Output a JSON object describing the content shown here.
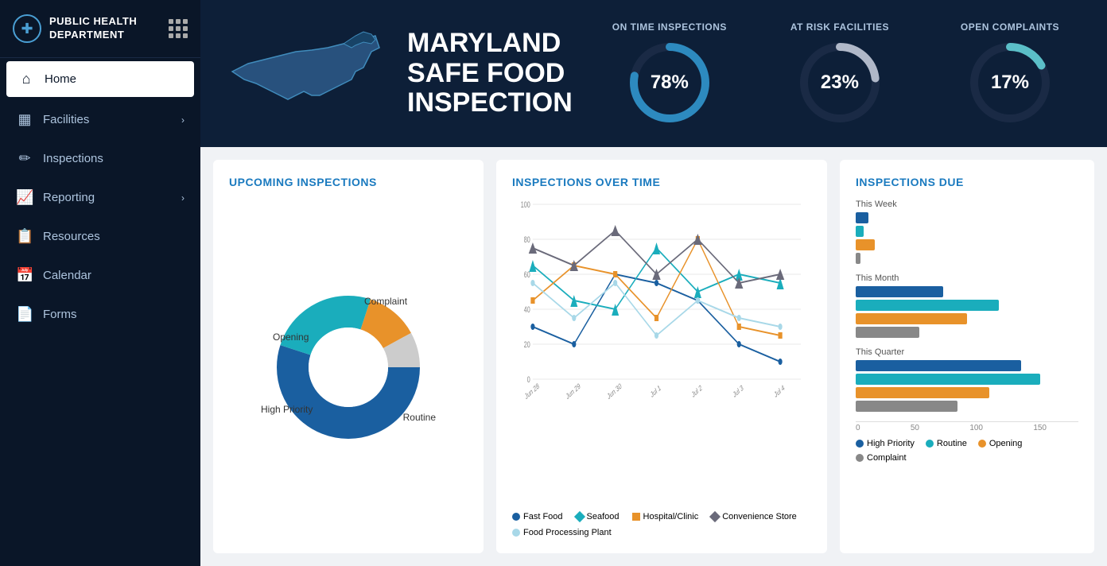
{
  "sidebar": {
    "logo_line1": "PUBLIC HEALTH",
    "logo_line2": "DEPARTMENT",
    "items": [
      {
        "id": "home",
        "label": "Home",
        "icon": "⌂",
        "active": true,
        "arrow": false
      },
      {
        "id": "facilities",
        "label": "Facilities",
        "icon": "▦",
        "active": false,
        "arrow": true
      },
      {
        "id": "inspections",
        "label": "Inspections",
        "icon": "✏",
        "active": false,
        "arrow": false
      },
      {
        "id": "reporting",
        "label": "Reporting",
        "icon": "📈",
        "active": false,
        "arrow": true
      },
      {
        "id": "resources",
        "label": "Resources",
        "icon": "📋",
        "active": false,
        "arrow": false
      },
      {
        "id": "calendar",
        "label": "Calendar",
        "icon": "📅",
        "active": false,
        "arrow": false
      },
      {
        "id": "forms",
        "label": "Forms",
        "icon": "📄",
        "active": false,
        "arrow": false
      }
    ]
  },
  "header": {
    "title_line1": "MARYLAND",
    "title_line2": "SAFE FOOD",
    "title_line3": "INSPECTION",
    "stats": [
      {
        "label": "ON TIME INSPECTIONS",
        "value": "78%",
        "percent": 78,
        "color": "#2d8abf"
      },
      {
        "label": "AT RISK FACILITIES",
        "value": "23%",
        "percent": 23,
        "color": "#b0b8c8"
      },
      {
        "label": "OPEN COMPLAINTS",
        "value": "17%",
        "percent": 17,
        "color": "#5bbfc8"
      }
    ]
  },
  "upcoming_inspections": {
    "title": "UPCOMING INSPECTIONS",
    "segments": [
      {
        "label": "Routine",
        "value": 55,
        "color": "#1a5fa0"
      },
      {
        "label": "High Priority",
        "value": 25,
        "color": "#1aadbc"
      },
      {
        "label": "Opening",
        "value": 12,
        "color": "#e8922a"
      },
      {
        "label": "Complaint",
        "value": 8,
        "color": "#ccc"
      }
    ]
  },
  "inspections_over_time": {
    "title": "INSPECTIONS OVER TIME",
    "y_labels": [
      100,
      80,
      60,
      40,
      20,
      0
    ],
    "x_labels": [
      "Jun 28",
      "Jun 29",
      "Jun 30",
      "Jul 1",
      "Jul 2",
      "Jul 3",
      "Jul 4"
    ],
    "series": [
      {
        "name": "Fast Food",
        "color": "#1a5fa0",
        "points": [
          30,
          20,
          60,
          55,
          45,
          20,
          10
        ]
      },
      {
        "name": "Seafood",
        "color": "#1aadbc",
        "points": [
          65,
          45,
          40,
          75,
          50,
          60,
          55
        ]
      },
      {
        "name": "Hospital/Clinic",
        "color": "#e8922a",
        "points": [
          45,
          65,
          60,
          35,
          80,
          30,
          25
        ]
      },
      {
        "name": "Convenience Store",
        "color": "#6a6a7a",
        "points": [
          75,
          65,
          85,
          60,
          80,
          55,
          60
        ]
      },
      {
        "name": "Food Processing Plant",
        "color": "#a8d8e8",
        "points": [
          55,
          35,
          55,
          25,
          45,
          35,
          30
        ]
      }
    ]
  },
  "inspections_due": {
    "title": "INSPECTIONS DUE",
    "groups": [
      {
        "label": "This Week",
        "bars": [
          {
            "type": "High Priority",
            "color": "#1a5fa0",
            "value": 8
          },
          {
            "type": "Routine",
            "color": "#1aadbc",
            "value": 5
          },
          {
            "type": "Opening",
            "color": "#e8922a",
            "value": 12
          },
          {
            "type": "Complaint",
            "color": "#888",
            "value": 3
          }
        ]
      },
      {
        "label": "This Month",
        "bars": [
          {
            "type": "High Priority",
            "color": "#1a5fa0",
            "value": 55
          },
          {
            "type": "Routine",
            "color": "#1aadbc",
            "value": 90
          },
          {
            "type": "Opening",
            "color": "#e8922a",
            "value": 70
          },
          {
            "type": "Complaint",
            "color": "#888",
            "value": 40
          }
        ]
      },
      {
        "label": "This Quarter",
        "bars": [
          {
            "type": "High Priority",
            "color": "#1a5fa0",
            "value": 130
          },
          {
            "type": "Routine",
            "color": "#1aadbc",
            "value": 145
          },
          {
            "type": "Opening",
            "color": "#e8922a",
            "value": 105
          },
          {
            "type": "Complaint",
            "color": "#888",
            "value": 80
          }
        ]
      }
    ],
    "axis_labels": [
      "0",
      "50",
      "100",
      "150"
    ],
    "max_value": 150,
    "legend": [
      {
        "label": "High Priority",
        "color": "#1a5fa0"
      },
      {
        "label": "Routine",
        "color": "#1aadbc"
      },
      {
        "label": "Opening",
        "color": "#e8922a"
      },
      {
        "label": "Complaint",
        "color": "#888"
      }
    ]
  }
}
